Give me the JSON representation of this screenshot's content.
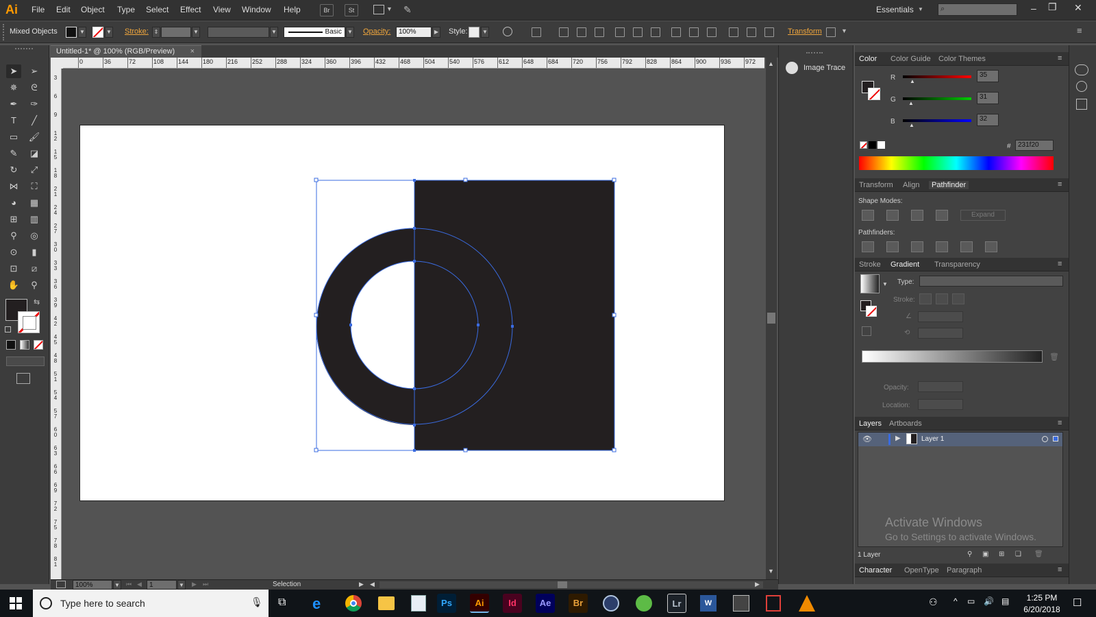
{
  "app": {
    "logo": "Ai"
  },
  "menubar": {
    "items": [
      "File",
      "Edit",
      "Object",
      "Type",
      "Select",
      "Effect",
      "View",
      "Window",
      "Help"
    ],
    "br": "Br",
    "st": "St",
    "workspace": "Essentials",
    "search_placeholder": ""
  },
  "control": {
    "mixed": "Mixed Objects",
    "stroke_label": "Stroke:",
    "basic": "Basic",
    "opacity_label": "Opacity:",
    "opacity_value": "100%",
    "style_label": "Style:",
    "transform": "Transform"
  },
  "document": {
    "tab_title": "Untitled-1* @ 100% (RGB/Preview)",
    "close": "×",
    "zoom": "100%",
    "artboard": "1",
    "status": "Selection"
  },
  "ruler": {
    "h": [
      "0",
      "36",
      "72",
      "108",
      "144",
      "180",
      "216",
      "252",
      "288",
      "324",
      "360",
      "396",
      "432",
      "468",
      "504",
      "540",
      "576",
      "612",
      "648",
      "684",
      "720",
      "756",
      "792",
      "828",
      "864",
      "900",
      "936",
      "972"
    ],
    "v": [
      "3",
      "6",
      "9",
      "1 2",
      "1 5",
      "1 8",
      "2 1",
      "2 4",
      "2 7",
      "3 0",
      "3 3",
      "3 6",
      "3 9",
      "4 2",
      "4 5",
      "4 8",
      "5 1",
      "5 4",
      "5 7",
      "6 0",
      "6 3",
      "6 6",
      "6 9",
      "7 2",
      "7 5",
      "7 8",
      "8 1"
    ]
  },
  "midpanel": {
    "image_trace": "Image Trace"
  },
  "color_panel": {
    "tabs": [
      "Color",
      "Color Guide",
      "Color Themes"
    ],
    "r_label": "R",
    "g_label": "G",
    "b_label": "B",
    "r": "35",
    "g": "31",
    "b": "32",
    "hash": "#",
    "hex": "231f20"
  },
  "pathfinder_panel": {
    "tabs": [
      "Transform",
      "Align",
      "Pathfinder"
    ],
    "shape_modes": "Shape Modes:",
    "expand": "Expand",
    "pathfinders": "Pathfinders:"
  },
  "gradient_panel": {
    "tabs": [
      "Stroke",
      "Gradient",
      "Transparency"
    ],
    "type_label": "Type:",
    "stroke_label": "Stroke:",
    "opacity_label": "Opacity:",
    "location_label": "Location:"
  },
  "layers_panel": {
    "tabs": [
      "Layers",
      "Artboards"
    ],
    "layer_name": "Layer 1",
    "count": "1 Layer",
    "watermark_title": "Activate Windows",
    "watermark_sub": "Go to Settings to activate Windows."
  },
  "character_panel": {
    "tabs": [
      "Character",
      "OpenType",
      "Paragraph"
    ]
  },
  "taskbar": {
    "search_placeholder": "Type here to search",
    "time": "1:25 PM",
    "date": "6/20/2018",
    "apps": [
      {
        "label": "Ps",
        "color": "#31a8ff",
        "bg": "#001e36"
      },
      {
        "label": "Ai",
        "color": "#ff9a00",
        "bg": "#330000"
      },
      {
        "label": "Id",
        "color": "#ff3366",
        "bg": "#49021f"
      },
      {
        "label": "Ae",
        "color": "#9999ff",
        "bg": "#00005b"
      },
      {
        "label": "Br",
        "color": "#e8a13a",
        "bg": "#2e1a00"
      },
      {
        "label": "Lr",
        "color": "#b9c4d0",
        "bg": "#1c2229"
      }
    ]
  },
  "colors": {
    "artwork": "#231f20",
    "selection": "#3a6be0",
    "accent": "#f0a63c"
  }
}
